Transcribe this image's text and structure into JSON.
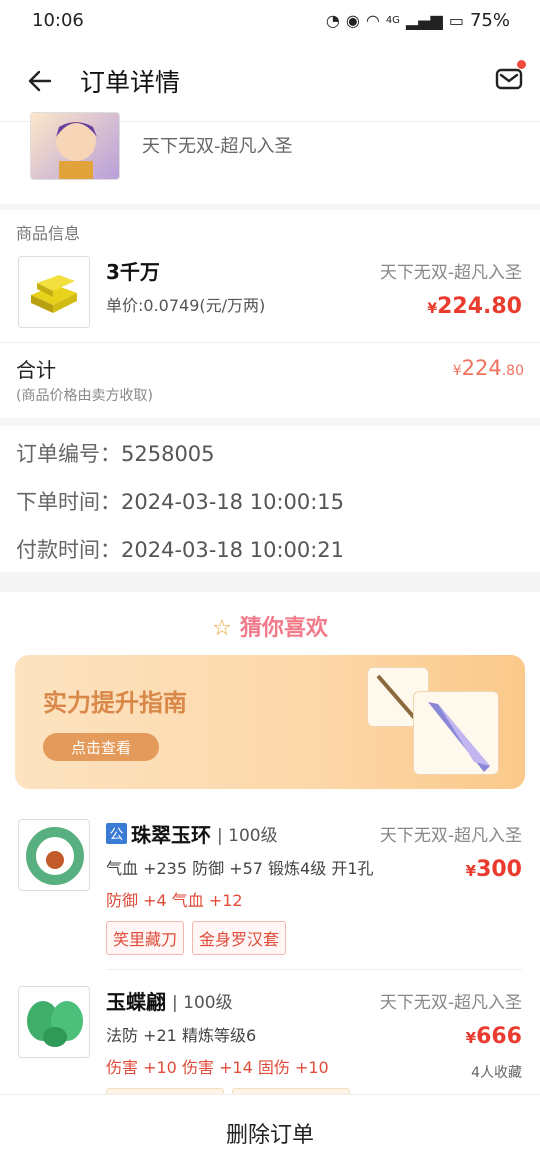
{
  "status_bar": {
    "time": "10:06",
    "network": "4G",
    "battery": "75%"
  },
  "header": {
    "title": "订单详情"
  },
  "server_card": {
    "server": "天下无双-超凡入圣"
  },
  "goods": {
    "section_label": "商品信息",
    "name": "3千万",
    "unit_price": "单价:0.0749(元/万两)",
    "server": "天下无双-超凡入圣",
    "price_symbol": "¥",
    "price_int": "224",
    "price_dec": ".80",
    "total_label": "合计",
    "total_note": "(商品价格由卖方收取)",
    "total_int": "224",
    "total_dec": ".80"
  },
  "order": {
    "number_label": "订单编号：",
    "number": "5258005",
    "created_label": "下单时间：",
    "created": "2024-03-18 10:00:15",
    "paid_label": "付款时间：",
    "paid": "2024-03-18 10:00:21"
  },
  "recommend": {
    "title": "猜你喜欢",
    "banner_title": "实力提升指南",
    "banner_button": "点击查看",
    "items": [
      {
        "badge": "公",
        "name": "珠翠玉环",
        "level": "| 100级",
        "attrs": "气血 +235 防御 +57 锻炼4级 开1孔",
        "red": "防御 +4 气血 +12",
        "server": "天下无双-超凡入圣",
        "price_symbol": "¥",
        "price": "300",
        "tags": [
          "笑里藏刀",
          "金身罗汉套"
        ]
      },
      {
        "name": "玉蝶翩",
        "level": "| 100级",
        "attrs": "法防 +21 精炼等级6",
        "red": "伤害 +10 伤害 +14 固伤 +10",
        "server": "天下无双-超凡入圣",
        "price_symbol": "¥",
        "price": "666",
        "favorites": "4人收藏"
      }
    ]
  },
  "bottom": {
    "delete_label": "删除订单"
  },
  "colors": {
    "price_red": "#ea3b2f",
    "accent_orange": "#e49a5a",
    "badge_blue": "#3a7bd5"
  }
}
